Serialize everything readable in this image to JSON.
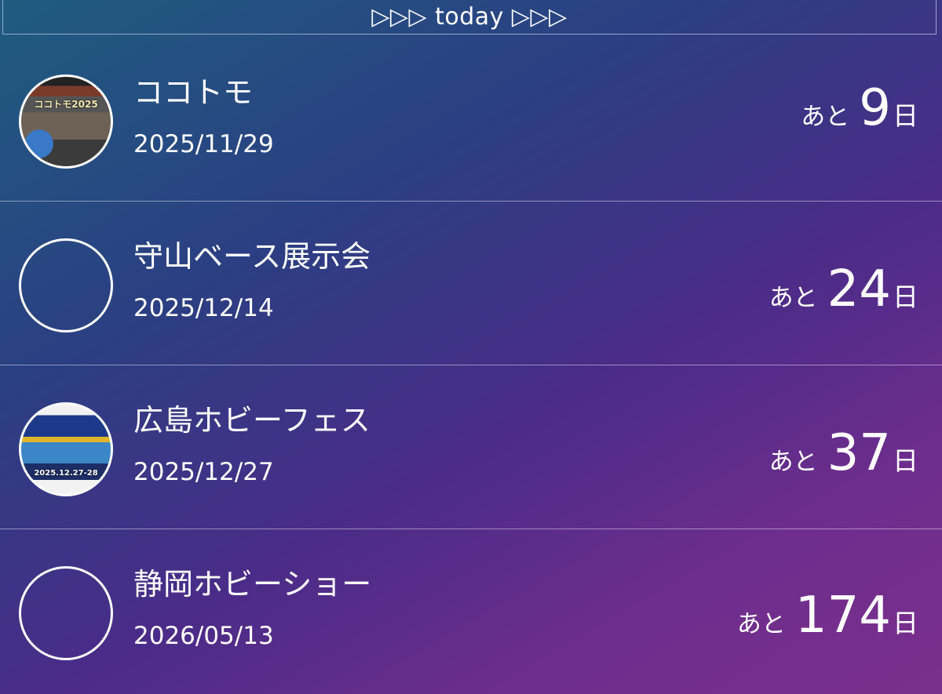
{
  "header": {
    "title": "▷▷▷ today ▷▷▷"
  },
  "countdown": {
    "prefix": "あと",
    "suffix": "日"
  },
  "events": [
    {
      "title": "ココトモ",
      "date": "2025/11/29",
      "days_left": "9",
      "thumbnail_caption": "ココトモ2025",
      "thumbnail": "event-poster"
    },
    {
      "title": "守山ベース展示会",
      "date": "2025/12/14",
      "days_left": "24",
      "thumbnail": "empty-circle"
    },
    {
      "title": "広島ホビーフェス",
      "date": "2025/12/27",
      "days_left": "37",
      "thumbnail_caption": "2025.12.27-28",
      "thumbnail": "event-poster"
    },
    {
      "title": "静岡ホビーショー",
      "date": "2026/05/13",
      "days_left": "174",
      "thumbnail": "empty-circle"
    }
  ]
}
